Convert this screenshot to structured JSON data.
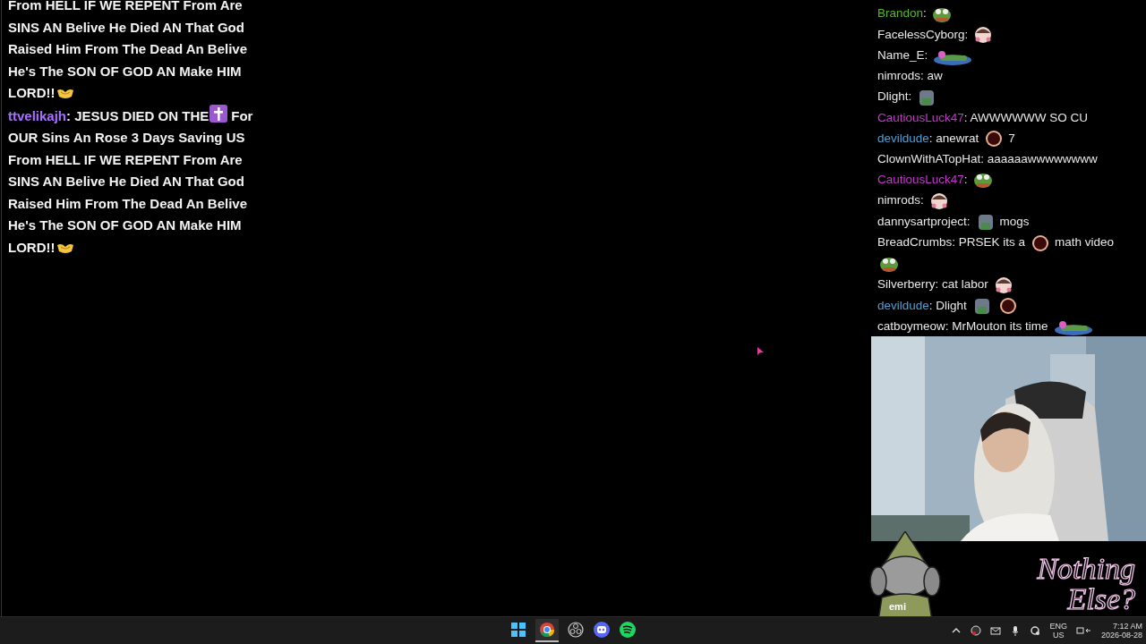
{
  "left_chat": {
    "messages": [
      {
        "lines": [
          [
            {
              "kind": "text",
              "text": "From HELL IF WE REPENT From Are"
            }
          ],
          [
            {
              "kind": "text",
              "text": "SINS AN Belive He Died AN That God"
            }
          ],
          [
            {
              "kind": "text",
              "text": "Raised Him From The Dead An Belive"
            }
          ],
          [
            {
              "kind": "text",
              "text": "He's The SON OF GOD AN Make HIM"
            }
          ],
          [
            {
              "kind": "text",
              "text": "LORD!!"
            },
            {
              "kind": "hands"
            }
          ]
        ]
      },
      {
        "user": "ttvelikajh",
        "color": "#a970ff",
        "lines": [
          [
            {
              "kind": "text",
              "text": ": JESUS DIED ON THE"
            },
            {
              "kind": "cross"
            },
            {
              "kind": "text",
              "text": "For"
            }
          ],
          [
            {
              "kind": "text",
              "text": "OUR Sins An Rose 3 Days Saving US"
            }
          ],
          [
            {
              "kind": "text",
              "text": "From HELL IF WE REPENT From Are"
            }
          ],
          [
            {
              "kind": "text",
              "text": "SINS AN Belive He Died AN That God"
            }
          ],
          [
            {
              "kind": "text",
              "text": "Raised Him From The Dead An Belive"
            }
          ],
          [
            {
              "kind": "text",
              "text": "He's The SON OF GOD AN Make HIM"
            }
          ],
          [
            {
              "kind": "text",
              "text": "LORD!!"
            },
            {
              "kind": "hands"
            }
          ]
        ]
      }
    ]
  },
  "right_chat": {
    "messages": [
      {
        "user": "Brandon",
        "color": "#5cb531",
        "parts": [
          {
            "kind": "text",
            "text": ":"
          },
          {
            "kind": "emote"
          }
        ]
      },
      {
        "user": "FacelessCyborg",
        "color": "#e8e8e8",
        "parts": [
          {
            "kind": "text",
            "text": ":"
          },
          {
            "kind": "emote"
          }
        ]
      },
      {
        "user": "Name_E",
        "color": "#e8e8e8",
        "parts": [
          {
            "kind": "text",
            "text": ":"
          },
          {
            "kind": "wide-emote"
          }
        ]
      },
      {
        "user": "nimrods",
        "color": "#e8e8e8",
        "parts": [
          {
            "kind": "text",
            "text": ": aw"
          }
        ]
      },
      {
        "user": "Dlight",
        "color": "#e8e8e8",
        "parts": [
          {
            "kind": "text",
            "text": ":"
          },
          {
            "kind": "emote"
          }
        ]
      },
      {
        "user": "CautiousLuck47",
        "color": "#c339c9",
        "parts": [
          {
            "kind": "text",
            "text": ": AWWWWWW SO CU"
          }
        ]
      },
      {
        "user": "devildude",
        "color": "#4f9fd6",
        "parts": [
          {
            "kind": "text",
            "text": ": anewrat"
          },
          {
            "kind": "emote"
          },
          {
            "kind": "text",
            "text": "7"
          }
        ]
      },
      {
        "user": "ClownWithATopHat",
        "color": "#e8e8e8",
        "parts": [
          {
            "kind": "text",
            "text": ": aaaaaawwwwwwww"
          }
        ]
      },
      {
        "user": "CautiousLuck47",
        "color": "#c339c9",
        "parts": [
          {
            "kind": "text",
            "text": ":"
          },
          {
            "kind": "emote"
          }
        ]
      },
      {
        "user": "nimrods",
        "color": "#e8e8e8",
        "parts": [
          {
            "kind": "text",
            "text": ":"
          },
          {
            "kind": "emote"
          }
        ]
      },
      {
        "user": "dannysartproject",
        "color": "#e8e8e8",
        "parts": [
          {
            "kind": "text",
            "text": ":"
          },
          {
            "kind": "emote"
          },
          {
            "kind": "text",
            "text": "mogs"
          }
        ]
      },
      {
        "user": "BreadCrumbs",
        "color": "#e8e8e8",
        "parts": [
          {
            "kind": "text",
            "text": ": PRSEK its a"
          },
          {
            "kind": "emote"
          },
          {
            "kind": "text",
            "text": "math video"
          },
          {
            "kind": "emote"
          }
        ]
      },
      {
        "user": "Silverberry",
        "color": "#e8e8e8",
        "parts": [
          {
            "kind": "text",
            "text": ": cat labor"
          },
          {
            "kind": "emote"
          }
        ]
      },
      {
        "user": "devildude",
        "color": "#4f9fd6",
        "parts": [
          {
            "kind": "text",
            "text": ": Dlight"
          },
          {
            "kind": "emote"
          },
          {
            "kind": "emote"
          }
        ]
      },
      {
        "user": "catboymeow",
        "color": "#e8e8e8",
        "parts": [
          {
            "kind": "text",
            "text": ": MrMouton its time"
          },
          {
            "kind": "wide-emote"
          }
        ]
      }
    ]
  },
  "mascot": {
    "label": "emi"
  },
  "logo": {
    "text": "Nothing Else?"
  },
  "taskbar": {
    "apps": [
      {
        "kind": "start",
        "selected": false
      },
      {
        "kind": "browser",
        "selected": true
      },
      {
        "kind": "recorder",
        "selected": false
      },
      {
        "kind": "chat",
        "selected": false
      },
      {
        "kind": "music",
        "selected": false
      }
    ],
    "tray": {
      "language": "ENG",
      "region": "US",
      "time": "7:12 AM",
      "date": "2026-08-28"
    }
  }
}
